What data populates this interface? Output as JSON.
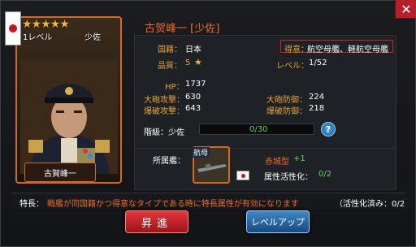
{
  "card": {
    "stars": "★★★★★",
    "level": "1レベル",
    "rank": "少佐",
    "name": "古賀峰一"
  },
  "title": "古贺峰一 [少佐]",
  "stats": {
    "nationality_label": "国籍：",
    "nationality": "日本",
    "specialty_label": "得意：",
    "specialty": "航空母艦、軽航空母艦",
    "quality_label": "品質：",
    "quality": "5",
    "level_label": "レベル：",
    "level": "1/52",
    "hp_label": "HP：",
    "hp": "1737",
    "cannon_atk_label": "大砲攻撃：",
    "cannon_atk": "630",
    "cannon_def_label": "大砲防御：",
    "cannon_def": "224",
    "bomb_atk_label": "爆破攻撃：",
    "bomb_atk": "643",
    "bomb_def_label": "爆破防御：",
    "bomb_def": "218",
    "rank_label": "階級：",
    "rank": "少佐",
    "rank_progress": "0/30",
    "rank_progress_fraction": 0
  },
  "ship": {
    "label": "所属艦：",
    "slot_badge": "航母",
    "name": "赤城型",
    "plus": "+1",
    "affinity_label": "属性活性化：",
    "affinity": "0/2"
  },
  "trait": {
    "label": "特長：",
    "text": "戦艦が同国籍かつ得意なタイプである時に特長属性が有効になります",
    "count": "（活性化済み：0/2）"
  },
  "buttons": {
    "promote": "昇進",
    "level_up": "レベルアップ",
    "close": "✕"
  },
  "colors": {
    "accent_orange": "#f26b2a",
    "label_gold": "#e8a43a",
    "promote_red": "#c8262c",
    "levelup_blue": "#2c6aa8"
  }
}
